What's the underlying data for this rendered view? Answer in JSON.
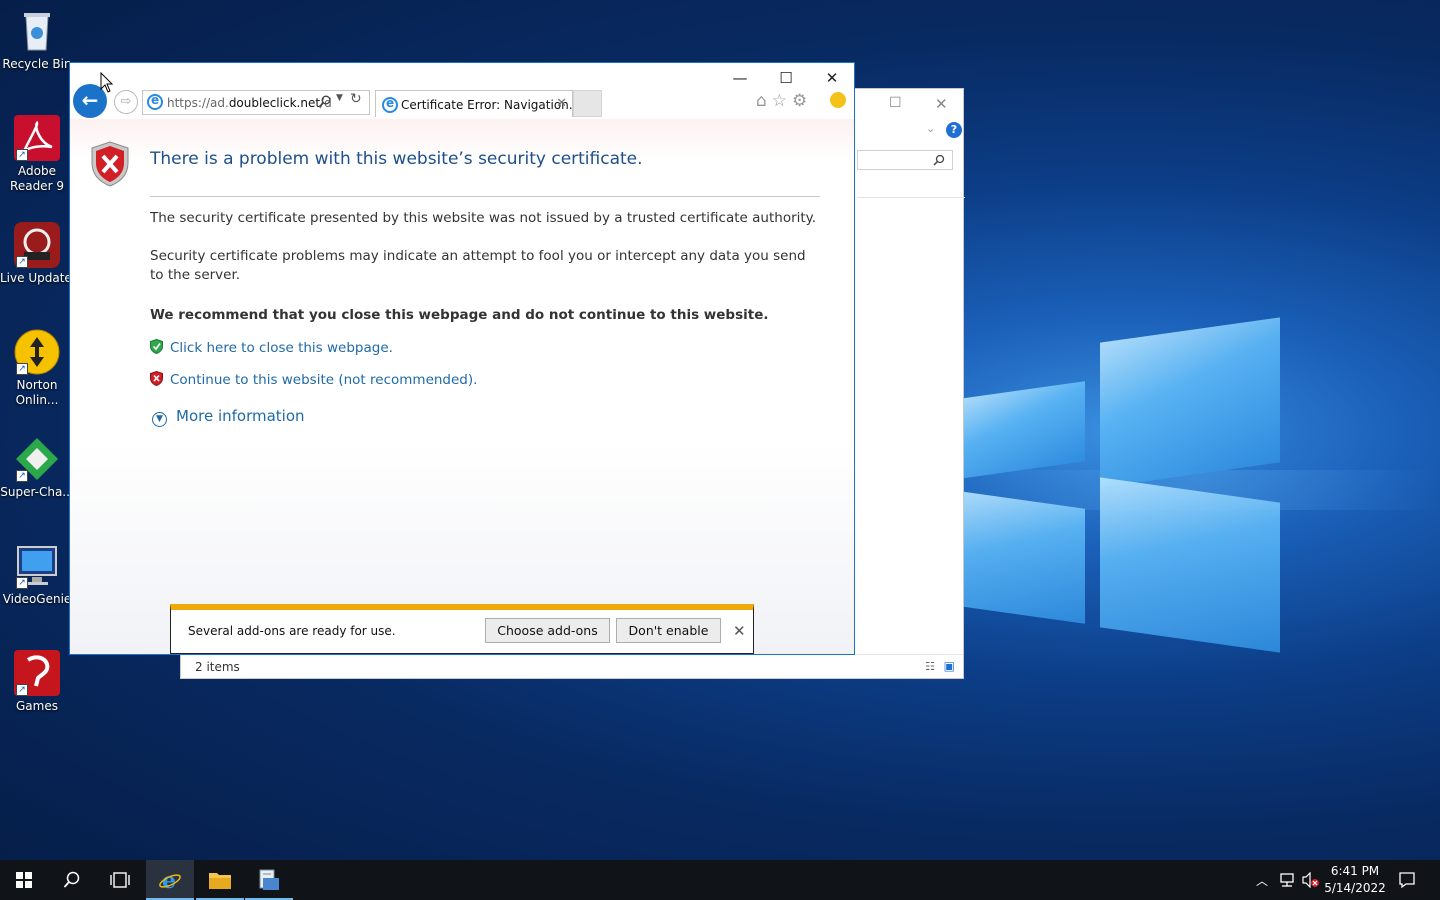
{
  "desktop": {
    "icons": [
      {
        "label": "Recycle Bin"
      },
      {
        "label": "Adobe Reader 9"
      },
      {
        "label": "Live Update 5"
      },
      {
        "label": "Norton Onlin..."
      },
      {
        "label": "Super-Cha..."
      },
      {
        "label": "VideoGenie"
      },
      {
        "label": "Games"
      }
    ]
  },
  "explorer": {
    "status": "2 items",
    "help": "?"
  },
  "browser": {
    "address": {
      "prefix": "https://ad.",
      "domain": "doubleclick.net",
      "suffix": "/d"
    },
    "tab_title": "Certificate Error: Navigation...",
    "page": {
      "title": "There is a problem with this website’s security certificate.",
      "para1": "The security certificate presented by this website was not issued by a trusted certificate authority.",
      "para2": "Security certificate problems may indicate an attempt to fool you or intercept any data you send to the server.",
      "recommend": "We recommend that you close this webpage and do not continue to this website.",
      "close_link": "Click here to close this webpage.",
      "continue_link": "Continue to this website (not recommended).",
      "more_info": "More information"
    },
    "notification": {
      "text": "Several add-ons are ready for use.",
      "choose": "Choose add-ons",
      "dont": "Don't enable"
    }
  },
  "taskbar": {
    "time": "6:41 PM",
    "date": "5/14/2022"
  },
  "colors": {
    "accent": "#1a73c9",
    "link": "#1f6aa8",
    "title": "#1e4f8a",
    "notif_bar": "#f0a80a"
  }
}
